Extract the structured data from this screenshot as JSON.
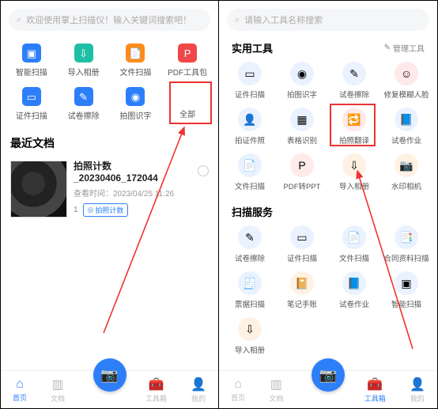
{
  "left": {
    "search_placeholder": "欢迎使用掌上扫描仪！输入关键词搜索吧！",
    "tools": [
      {
        "label": "智能扫描",
        "color": "ic-blue",
        "glyph": "▣"
      },
      {
        "label": "导入相册",
        "color": "ic-teal",
        "glyph": "⇩"
      },
      {
        "label": "文件扫描",
        "color": "ic-orange",
        "glyph": "📄"
      },
      {
        "label": "PDF工具包",
        "color": "ic-red",
        "glyph": "P"
      },
      {
        "label": "证件扫描",
        "color": "ic-blue",
        "glyph": "▭"
      },
      {
        "label": "试卷擦除",
        "color": "ic-blue",
        "glyph": "✎"
      },
      {
        "label": "拍图识字",
        "color": "ic-blue",
        "glyph": "◉"
      },
      {
        "label": "全部",
        "color": "ic-dots",
        "glyph": ""
      }
    ],
    "recent_title": "最近文档",
    "doc": {
      "name": "拍照计数_20230406_172044",
      "meta": "查看时间：2023/04/25 11:26",
      "count": "1",
      "tag": "拍照计数"
    },
    "nav": [
      "首页",
      "文档",
      "",
      "工具箱",
      "我的"
    ]
  },
  "right": {
    "search_placeholder": "请输入工具名称搜索",
    "practical_title": "实用工具",
    "manage_label": "管理工具",
    "practical": [
      {
        "label": "证件扫描",
        "g": "▭",
        "c": ""
      },
      {
        "label": "拍图识字",
        "g": "◉",
        "c": ""
      },
      {
        "label": "试卷擦除",
        "g": "✎",
        "c": ""
      },
      {
        "label": "修复模糊人脸",
        "g": "☺",
        "c": "red-bg"
      },
      {
        "label": "拍证件照",
        "g": "👤",
        "c": ""
      },
      {
        "label": "表格识别",
        "g": "▦",
        "c": ""
      },
      {
        "label": "拍照翻译",
        "g": "🔁",
        "c": "red-bg"
      },
      {
        "label": "试卷作业",
        "g": "📘",
        "c": ""
      },
      {
        "label": "文件扫描",
        "g": "📄",
        "c": ""
      },
      {
        "label": "PDF转PPT",
        "g": "P",
        "c": "red-bg"
      },
      {
        "label": "导入相册",
        "g": "⇩",
        "c": "orange-bg"
      },
      {
        "label": "水印相机",
        "g": "📷",
        "c": "orange-bg"
      }
    ],
    "scan_title": "扫描服务",
    "scan": [
      {
        "label": "试卷擦除",
        "g": "✎",
        "c": ""
      },
      {
        "label": "证件扫描",
        "g": "▭",
        "c": ""
      },
      {
        "label": "文件扫描",
        "g": "📄",
        "c": ""
      },
      {
        "label": "合同资料扫描",
        "g": "📑",
        "c": ""
      },
      {
        "label": "票据扫描",
        "g": "🧾",
        "c": ""
      },
      {
        "label": "笔记手账",
        "g": "📔",
        "c": "orange-bg"
      },
      {
        "label": "试卷作业",
        "g": "📘",
        "c": ""
      },
      {
        "label": "智能扫描",
        "g": "▣",
        "c": ""
      },
      {
        "label": "导入相册",
        "g": "⇩",
        "c": "orange-bg"
      }
    ],
    "nav": [
      "首页",
      "文档",
      "",
      "工具箱",
      "我的"
    ]
  }
}
